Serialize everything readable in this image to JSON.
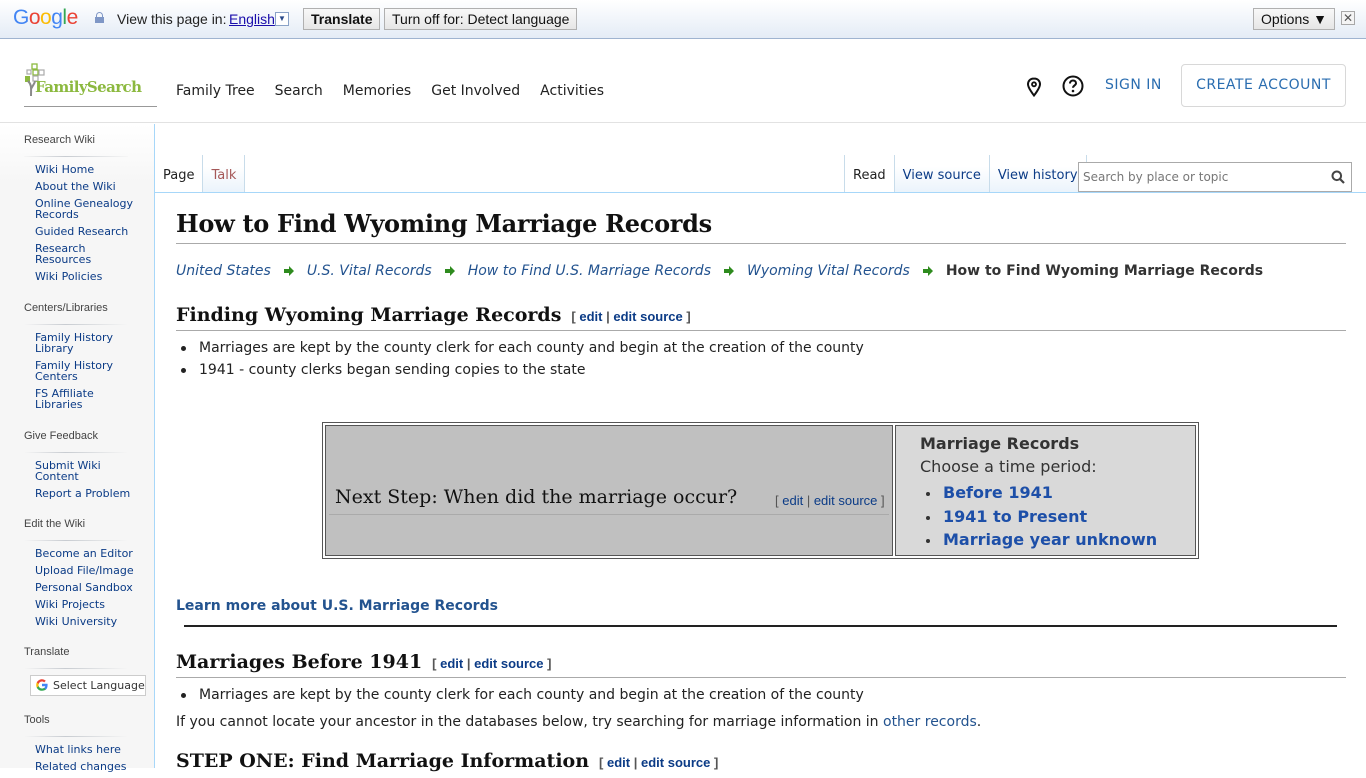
{
  "translate_bar": {
    "logo": [
      "G",
      "o",
      "o",
      "g",
      "l",
      "e"
    ],
    "view_label": "View this page in:",
    "language": "English",
    "translate_button": "Translate",
    "turn_off_button": "Turn off for: Detect language",
    "options_button": "Options ▼",
    "close_symbol": "✕"
  },
  "header": {
    "logo_text": "FamilySearch",
    "nav": [
      "Family Tree",
      "Search",
      "Memories",
      "Get Involved",
      "Activities"
    ],
    "location_icon": "map-pin-icon",
    "help_icon": "question-circle-icon",
    "sign_in": "SIGN IN",
    "create_account": "CREATE ACCOUNT"
  },
  "sidebar": {
    "sections": [
      {
        "heading": "Research Wiki",
        "items": [
          "Wiki Home",
          "About the Wiki",
          "Online Genealogy Records",
          "Guided Research",
          "Research Resources",
          "Wiki Policies"
        ]
      },
      {
        "heading": "Centers/Libraries",
        "items": [
          "Family History Library",
          "Family History Centers",
          "FS Affiliate Libraries"
        ]
      },
      {
        "heading": "Give Feedback",
        "items": [
          "Submit Wiki Content",
          "Report a Problem"
        ]
      },
      {
        "heading": "Edit the Wiki",
        "items": [
          "Become an Editor",
          "Upload File/Image",
          "Personal Sandbox",
          "Wiki Projects",
          "Wiki University"
        ]
      },
      {
        "heading": "Translate",
        "select_language": "Select Language"
      },
      {
        "heading": "Tools",
        "items": [
          "What links here",
          "Related changes"
        ]
      }
    ]
  },
  "tabs": {
    "left": [
      "Page",
      "Talk"
    ],
    "right": [
      "Read",
      "View source",
      "View history"
    ],
    "search_placeholder": "Search by place or topic"
  },
  "page": {
    "title": "How to Find Wyoming Marriage Records",
    "breadcrumb": {
      "links": [
        "United States",
        "U.S. Vital Records",
        "How to Find U.S. Marriage Records",
        "Wyoming Vital Records"
      ],
      "current": "How to Find Wyoming Marriage Records"
    },
    "edit_label": "edit",
    "edit_source_label": "edit source",
    "section1": {
      "heading": "Finding Wyoming Marriage Records",
      "bullets": [
        "Marriages are kept by the county clerk for each county and begin at the creation of the county",
        "1941 - county clerks began sending copies to the state"
      ]
    },
    "next_step": {
      "heading": "Next Step: When did the marriage occur?",
      "box_title": "Marriage Records",
      "box_subtitle": "Choose a time period:",
      "options": [
        "Before 1941",
        "1941 to Present",
        "Marriage year unknown"
      ]
    },
    "learn_more": "Learn more about U.S. Marriage Records",
    "section2": {
      "heading": "Marriages Before 1941",
      "bullets": [
        "Marriages are kept by the county clerk for each county and begin at the creation of the county"
      ],
      "para_before_link": "If you cannot locate your ancestor in the databases below, try searching for marriage information in ",
      "para_link": "other records",
      "para_after_link": "."
    },
    "section3": {
      "heading": "STEP ONE: Find Marriage Information"
    }
  }
}
